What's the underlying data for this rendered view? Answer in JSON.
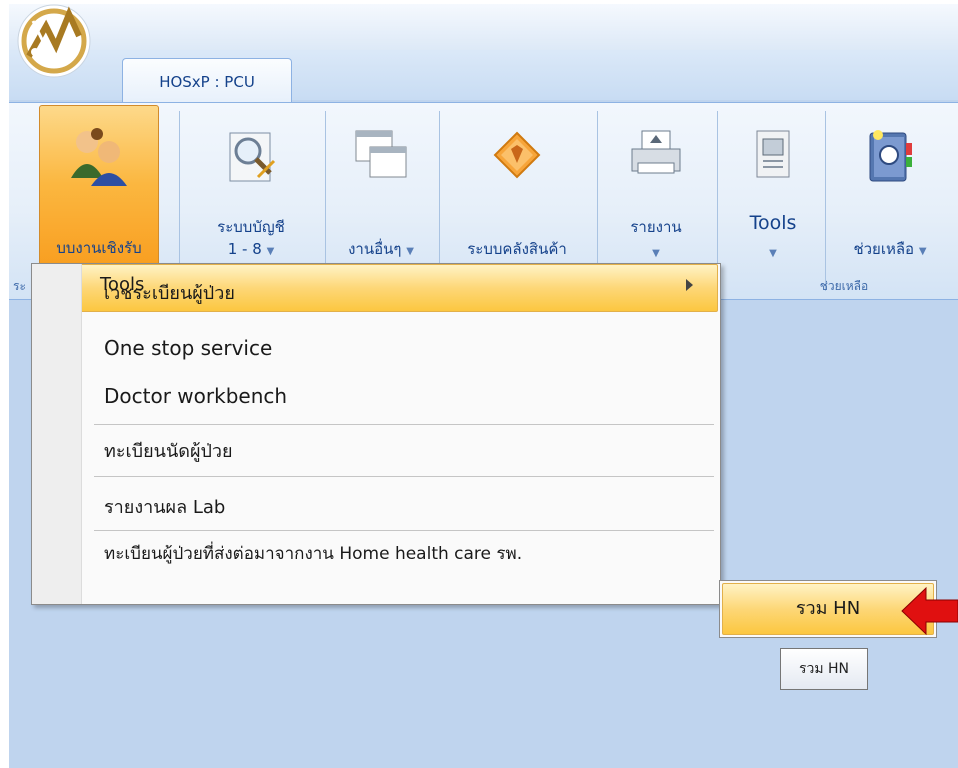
{
  "app": {
    "tab_title": "HOSxP : PCU"
  },
  "ribbon": {
    "buttons": [
      {
        "label": "บบงานเชิงรับ",
        "icon": "users-icon"
      },
      {
        "label_line1": "ระบบบัญชี",
        "label_line2": "1 - 8",
        "icon": "document-search-icon"
      },
      {
        "label": "งานอื่นๆ",
        "icon": "windows-icon"
      },
      {
        "label": "ระบบคลังสินค้า",
        "icon": "warehouse-icon"
      },
      {
        "label": "รายงาน",
        "icon": "printer-icon"
      },
      {
        "label": "Tools",
        "icon": "tools-icon"
      },
      {
        "label": "ช่วยเหลือ",
        "icon": "help-book-icon"
      }
    ],
    "group_labels": {
      "left": "ระ",
      "help": "ช่วยเหลือ"
    }
  },
  "menu": {
    "items": [
      "เวชระเบียนผู้ป่วย",
      "One stop service",
      "Doctor workbench",
      "ทะเบียนนัดผู้ป่วย",
      "รายงานผล Lab",
      "ทะเบียนผู้ป่วยที่ส่งต่อมาจากงาน Home health care รพ."
    ],
    "tools": "Tools"
  },
  "submenu": {
    "item": "รวม HN"
  },
  "tooltip": "รวม HN",
  "colors": {
    "highlight": "#fcc740",
    "ribbon_text": "#15428b",
    "arrow": "#e01010"
  }
}
